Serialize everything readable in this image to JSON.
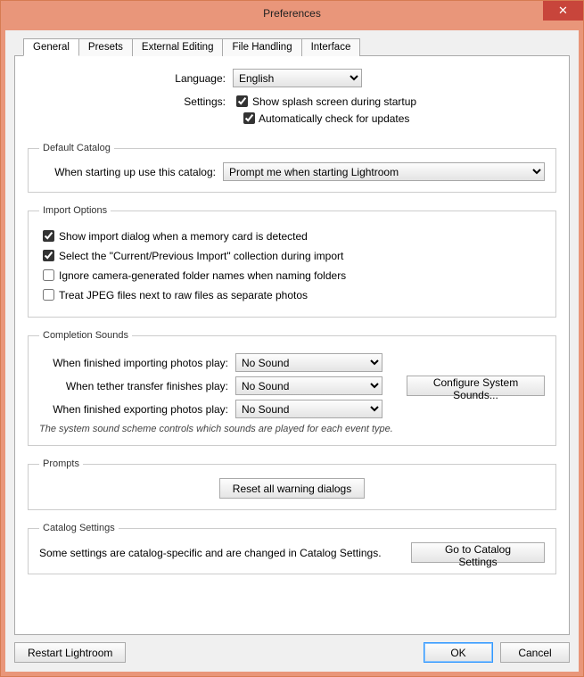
{
  "window": {
    "title": "Preferences"
  },
  "tabs": [
    "General",
    "Presets",
    "External Editing",
    "File Handling",
    "Interface"
  ],
  "active_tab": "General",
  "general": {
    "language_label": "Language:",
    "language_value": "English",
    "settings_label": "Settings:",
    "show_splash_label": "Show splash screen during startup",
    "show_splash_checked": true,
    "auto_update_label": "Automatically check for updates",
    "auto_update_checked": true
  },
  "default_catalog": {
    "legend": "Default Catalog",
    "label": "When starting up use this catalog:",
    "value": "Prompt me when starting Lightroom"
  },
  "import_options": {
    "legend": "Import Options",
    "items": [
      {
        "label": "Show import dialog when a memory card is detected",
        "checked": true
      },
      {
        "label": "Select the \"Current/Previous Import\" collection during import",
        "checked": true
      },
      {
        "label": "Ignore camera-generated folder names when naming folders",
        "checked": false
      },
      {
        "label": "Treat JPEG files next to raw files as separate photos",
        "checked": false
      }
    ]
  },
  "completion_sounds": {
    "legend": "Completion Sounds",
    "rows": [
      {
        "label": "When finished importing photos play:",
        "value": "No Sound"
      },
      {
        "label": "When tether transfer finishes play:",
        "value": "No Sound"
      },
      {
        "label": "When finished exporting photos play:",
        "value": "No Sound"
      }
    ],
    "configure_btn": "Configure System Sounds...",
    "hint": "The system sound scheme controls which sounds are played for each event type."
  },
  "prompts": {
    "legend": "Prompts",
    "reset_btn": "Reset all warning dialogs"
  },
  "catalog_settings": {
    "legend": "Catalog Settings",
    "text": "Some settings are catalog-specific and are changed in Catalog Settings.",
    "btn": "Go to Catalog Settings"
  },
  "footer": {
    "restart": "Restart Lightroom",
    "ok": "OK",
    "cancel": "Cancel"
  }
}
